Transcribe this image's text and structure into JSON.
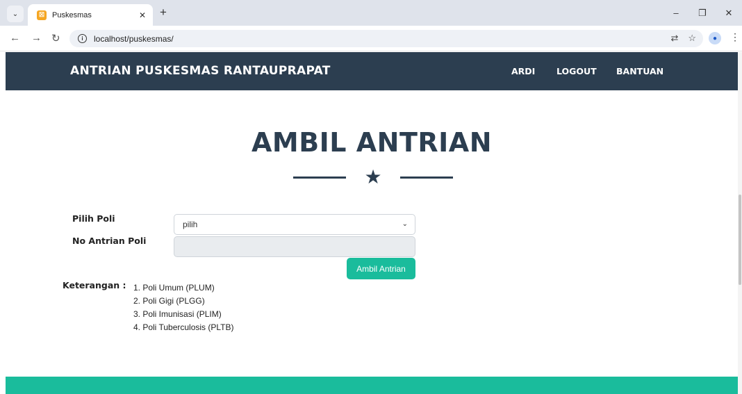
{
  "browser": {
    "tab_title": "Puskesmas",
    "favicon_glyph": "☒",
    "url": "localhost/puskesmas/",
    "icons": [
      "tab-search-icon",
      "close-icon",
      "plus-icon",
      "back-icon",
      "forward-icon",
      "reload-icon",
      "info-icon",
      "translate-icon",
      "star-icon",
      "profile-icon",
      "kebab-menu-icon",
      "minimize-icon",
      "restore-icon"
    ]
  },
  "navbar": {
    "brand": "ANTRIAN PUSKESMAS RANTAUPRAPAT",
    "links": [
      "ARDI",
      "LOGOUT",
      "BANTUAN"
    ]
  },
  "main": {
    "heading": "AMBIL ANTRIAN",
    "form": {
      "poli_label": "Pilih Poli",
      "poli_selected": "pilih",
      "antrian_label": "No Antrian Poli",
      "antrian_value": "",
      "submit_label": "Ambil Antrian"
    },
    "keterangan": {
      "label": "Keterangan :",
      "items": [
        "1. Poli Umum (PLUM)",
        "2. Poli Gigi (PLGG)",
        "3. Poli Imunisasi (PLIM)",
        "4. Poli Tuberculosis (PLTB)"
      ]
    }
  },
  "colors": {
    "navbar": "#2c3e50",
    "accent": "#1abc9c"
  }
}
